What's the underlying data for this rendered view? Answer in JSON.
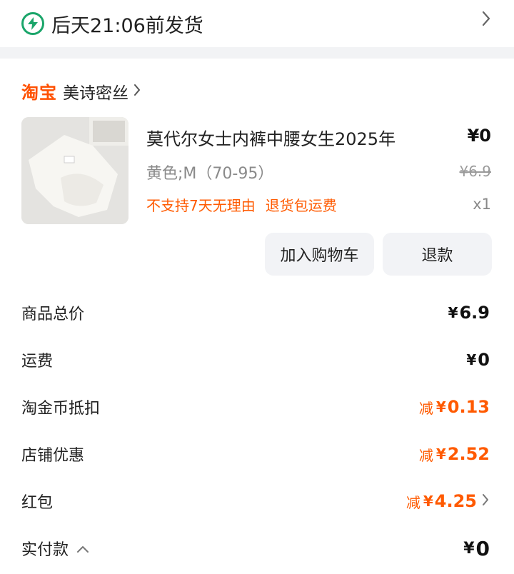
{
  "shipping": {
    "text": "后天21:06前发货"
  },
  "shop": {
    "platform_logo": "淘宝",
    "name": "美诗密丝"
  },
  "product": {
    "title": "莫代尔女士内裤中腰女生2025年",
    "variant": "黄色;M（70-95）",
    "price": "¥0",
    "original_price": "¥6.9",
    "quantity": "x1",
    "tag_1": "不支持7天无理由",
    "tag_2": "退货包运费"
  },
  "actions": {
    "add_to_cart": "加入购物车",
    "refund": "退款"
  },
  "summary": {
    "total_label": "商品总价",
    "total_symbol": "¥",
    "total_value": "6.9",
    "shipping_label": "运费",
    "shipping_symbol": "¥",
    "shipping_value": "0",
    "coin_label": "淘金币抵扣",
    "coin_prefix": "减",
    "coin_symbol": "¥",
    "coin_value": "0.13",
    "store_label": "店铺优惠",
    "store_prefix": "减",
    "store_symbol": "¥",
    "store_value": "2.52",
    "redpacket_label": "红包",
    "redpacket_prefix": "减",
    "redpacket_symbol": "¥",
    "redpacket_value": "4.25",
    "paid_label": "实付款",
    "paid_symbol": "¥",
    "paid_value": "0"
  },
  "colors": {
    "accent_green": "#1aa56a",
    "accent_orange": "#ff5a00",
    "taobao_orange": "#ff5000"
  }
}
